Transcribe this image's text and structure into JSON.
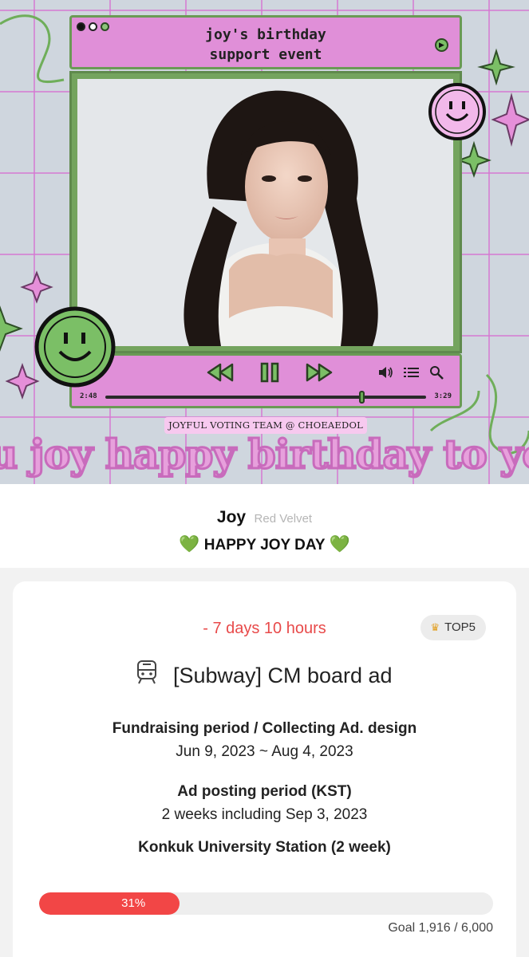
{
  "banner": {
    "title_line1": "joy's birthday",
    "title_line2": "support event",
    "time_current": "2:48",
    "time_total": "3:29",
    "playback_progress": 0.8,
    "credit": "JOYFUL VOTING TEAM @ CHOEAEDOL",
    "big_text": "u joy happy birthday to yo"
  },
  "artist": {
    "name": "Joy",
    "group": "Red Velvet"
  },
  "headline": {
    "heart_left": "💚",
    "text": "HAPPY JOY DAY",
    "heart_right": "💚"
  },
  "card": {
    "countdown": "- 7 days 10 hours",
    "badge": {
      "icon": "crown-icon",
      "label": "TOP5"
    },
    "product": {
      "icon": "subway-train-icon",
      "title": "[Subway] CM board ad"
    },
    "fundraising_label": "Fundraising period / Collecting Ad. design",
    "fundraising_value": "Jun 9, 2023 ~ Aug 4, 2023",
    "posting_label": "Ad posting period (KST)",
    "posting_value": "2 weeks including Sep 3, 2023",
    "location": "Konkuk University Station (2 week)",
    "progress": {
      "percent_label": "31%",
      "fraction": 0.31
    },
    "goal": "Goal 1,916 / 6,000"
  },
  "colors": {
    "accent_red": "#f24646",
    "banner_pink": "#e08fd8",
    "banner_green": "#74a45e"
  }
}
